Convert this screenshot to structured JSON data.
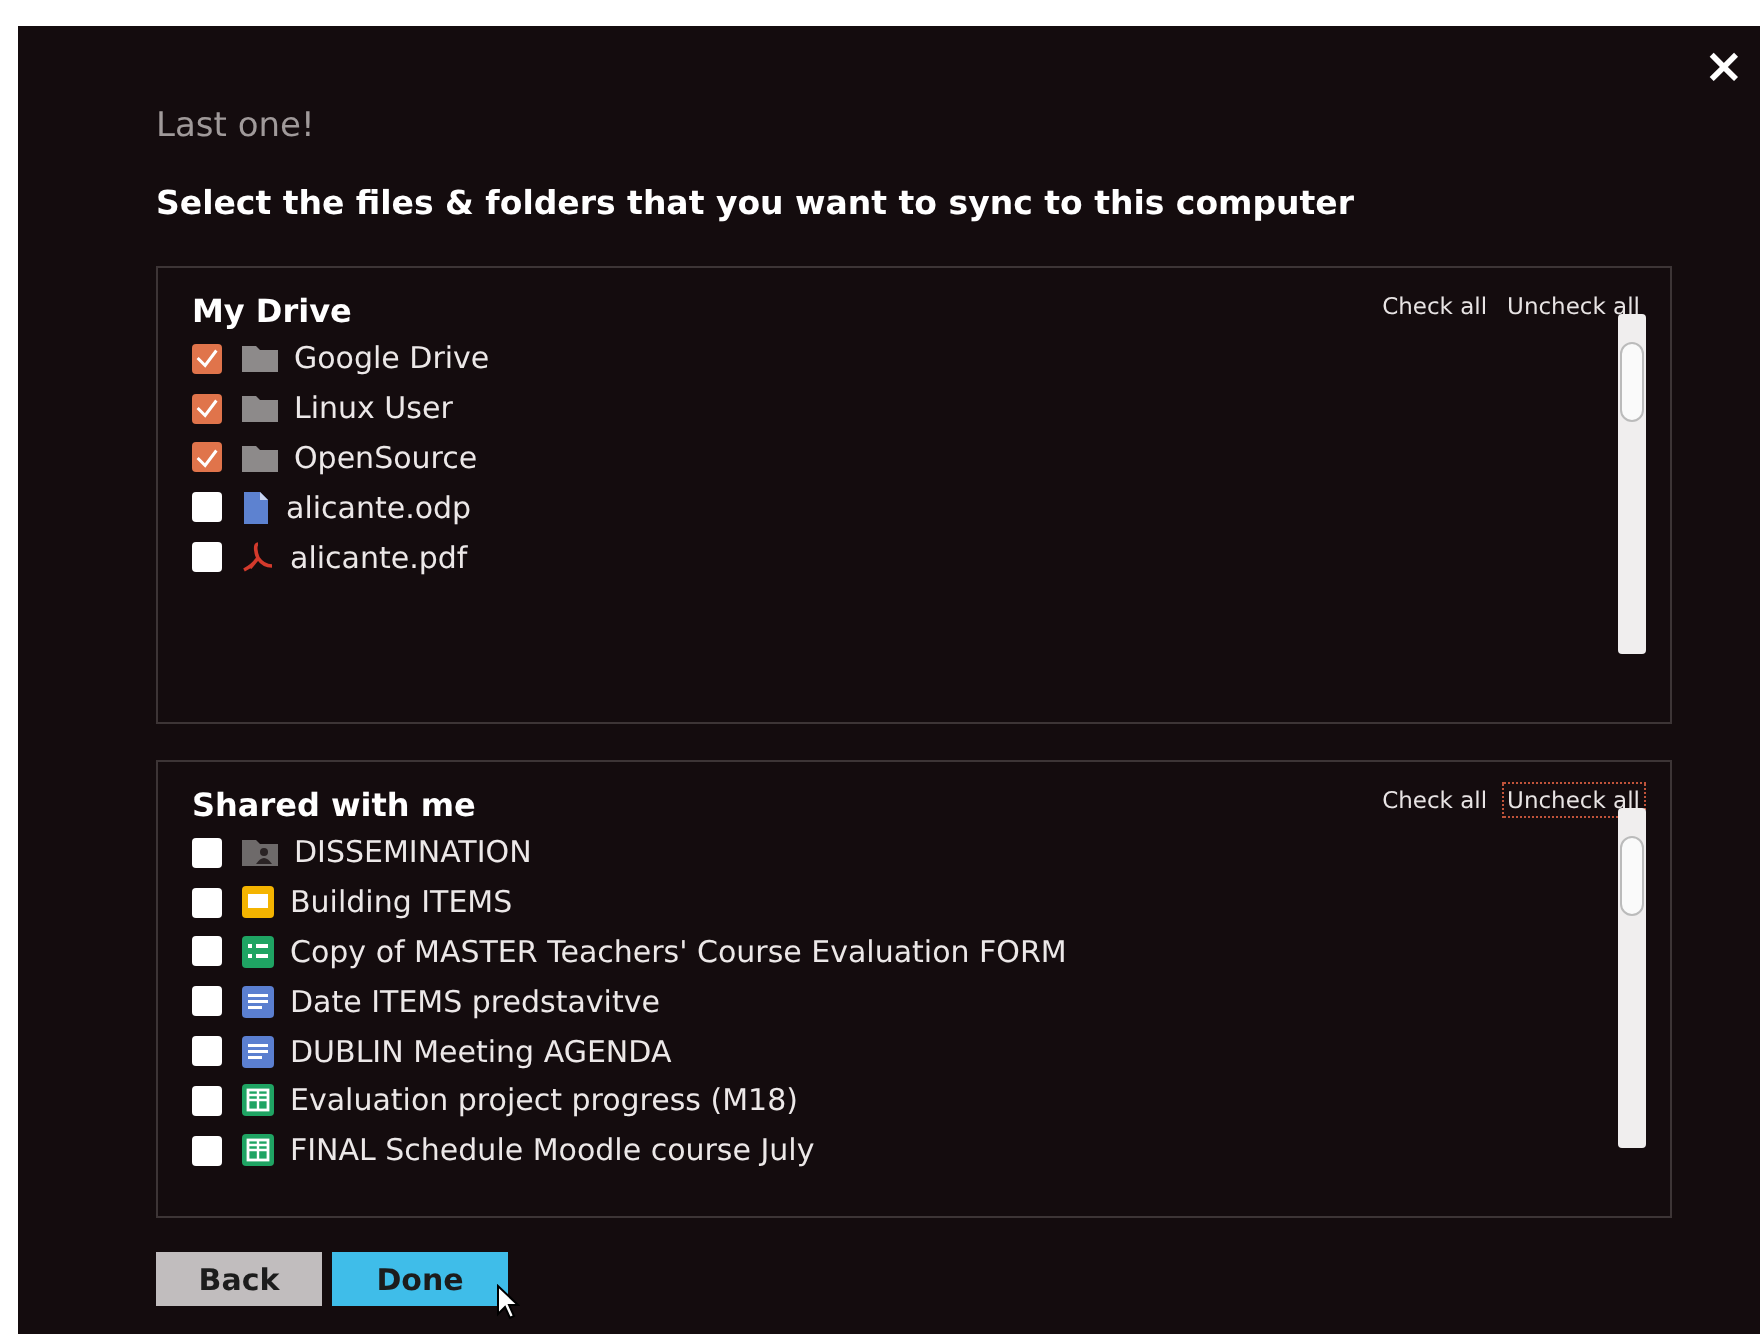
{
  "close": "×",
  "step": "Last one!",
  "heading": "Select the files & folders that you want to sync to this computer",
  "sections": [
    {
      "title": "My Drive",
      "check_all": "Check all",
      "uncheck_all": "Uncheck all",
      "uncheck_focused": false,
      "items": [
        {
          "name": "Google Drive",
          "kind": "folder",
          "checked": true
        },
        {
          "name": "Linux User",
          "kind": "folder",
          "checked": true
        },
        {
          "name": "OpenSource",
          "kind": "folder",
          "checked": true
        },
        {
          "name": "alicante.odp",
          "kind": "doc",
          "checked": false
        },
        {
          "name": "alicante.pdf",
          "kind": "pdf",
          "checked": false
        }
      ]
    },
    {
      "title": "Shared with me",
      "check_all": "Check all",
      "uncheck_all": "Uncheck all",
      "uncheck_focused": true,
      "items": [
        {
          "name": "DISSEMINATION",
          "kind": "shared-folder",
          "checked": false
        },
        {
          "name": "Building ITEMS",
          "kind": "slides",
          "checked": false
        },
        {
          "name": "Copy of MASTER Teachers' Course Evaluation FORM",
          "kind": "form",
          "checked": false
        },
        {
          "name": "Date ITEMS predstavitve",
          "kind": "doc-lines",
          "checked": false
        },
        {
          "name": "DUBLIN Meeting AGENDA",
          "kind": "doc-lines",
          "checked": false
        },
        {
          "name": "Evaluation project progress (M18)",
          "kind": "sheet",
          "checked": false
        },
        {
          "name": "FINAL Schedule Moodle course July",
          "kind": "sheet",
          "checked": false
        }
      ]
    }
  ],
  "buttons": [
    {
      "label": "Back",
      "kind": "secondary"
    },
    {
      "label": "Done",
      "kind": "primary"
    }
  ]
}
